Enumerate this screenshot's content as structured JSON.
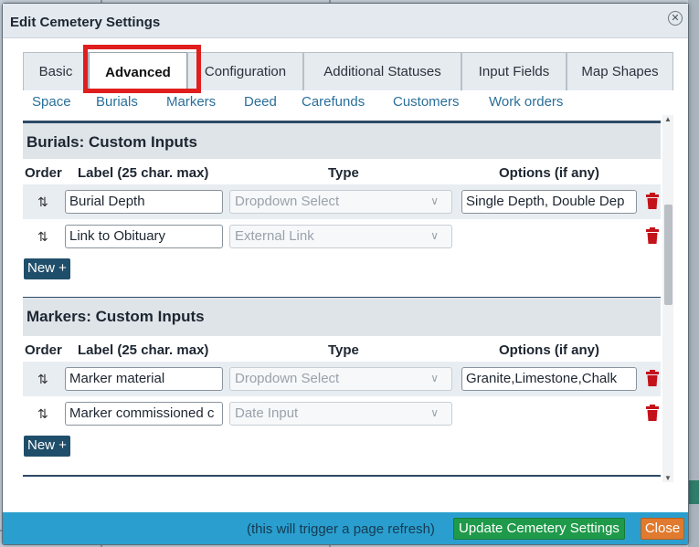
{
  "modal": {
    "title": "Edit Cemetery Settings"
  },
  "tabs": [
    {
      "label": "Basic"
    },
    {
      "label": "Advanced",
      "active": true
    },
    {
      "label": "Configuration"
    },
    {
      "label": "Additional Statuses"
    },
    {
      "label": "Input Fields"
    },
    {
      "label": "Map Shapes"
    }
  ],
  "subtabs": [
    "Space",
    "Burials",
    "Markers",
    "Deed",
    "Carefunds",
    "Customers",
    "Work orders"
  ],
  "columns": {
    "order": "Order",
    "label": "Label (25 char. max)",
    "type": "Type",
    "options": "Options (if any)"
  },
  "sections": [
    {
      "title": "Burials: Custom Inputs",
      "rows": [
        {
          "label": "Burial Depth",
          "type": "Dropdown Select",
          "options": "Single Depth, Double Dep"
        },
        {
          "label": "Link to Obituary",
          "type": "External Link",
          "options": ""
        }
      ],
      "new_label": "New +"
    },
    {
      "title": "Markers: Custom Inputs",
      "rows": [
        {
          "label": "Marker material",
          "type": "Dropdown Select",
          "options": "Granite,Limestone,Chalk"
        },
        {
          "label": "Marker commissioned c",
          "type": "Date Input",
          "options": ""
        }
      ],
      "new_label": "New +"
    }
  ],
  "footer": {
    "note": "(this will trigger a page refresh)",
    "update_label": "Update Cemetery Settings",
    "close_label": "Close"
  },
  "colors": {
    "highlight": "#e01e1e",
    "footer": "#2a9fcf",
    "update": "#1f9a4a",
    "close": "#e07a2e",
    "trash": "#c4121a"
  },
  "icons": {
    "drag": "up-down-arrows-icon",
    "delete": "trash-icon",
    "close": "close-circle-icon"
  }
}
